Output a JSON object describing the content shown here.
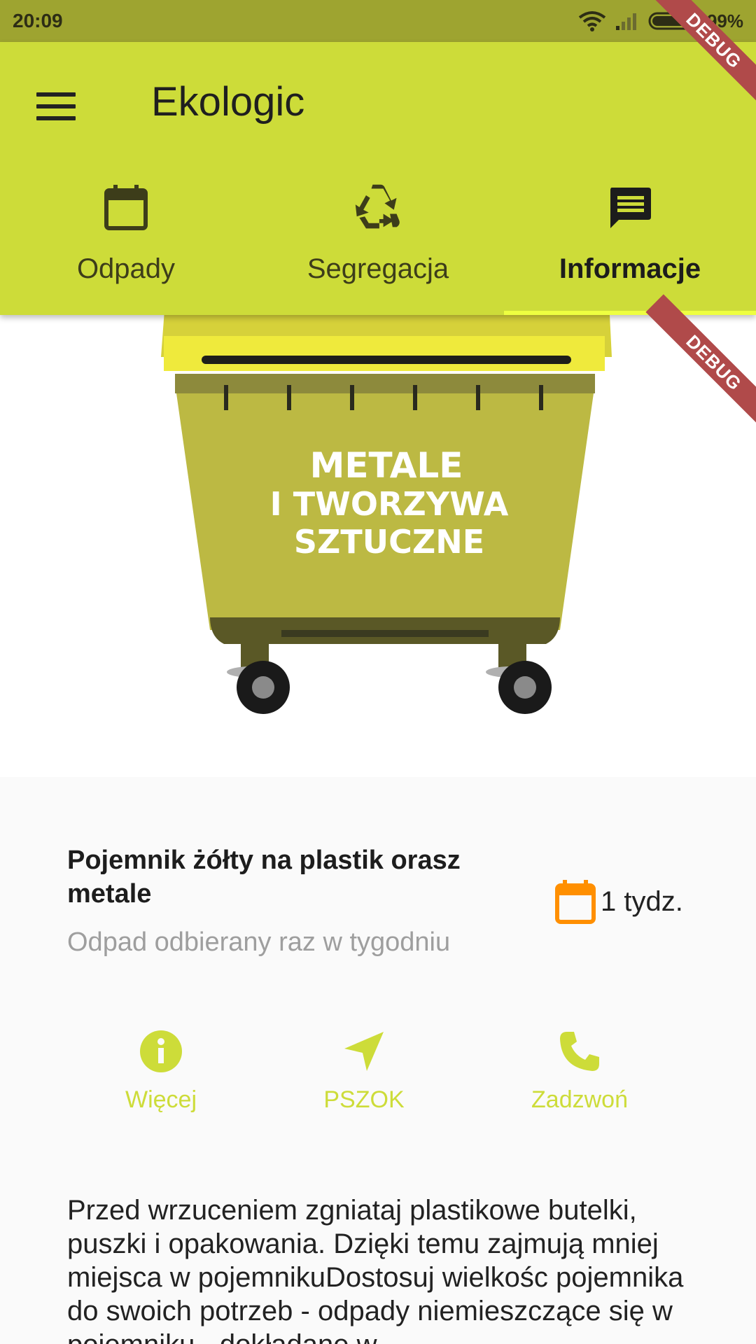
{
  "status": {
    "time": "20:09",
    "battery": "99%"
  },
  "app": {
    "title": "Ekologic"
  },
  "tabs": [
    {
      "label": "Odpady",
      "icon": "calendar-icon"
    },
    {
      "label": "Segregacja",
      "icon": "recycle-icon"
    },
    {
      "label": "Informacje",
      "icon": "message-icon",
      "active": true
    }
  ],
  "debug": {
    "label": "DEBUG"
  },
  "bin": {
    "line1": "METALE",
    "line2": "I TWORZYWA",
    "line3": "SZTUCZNE"
  },
  "info": {
    "title": "Pojemnik żółty na plastik orasz metale",
    "subtitle": "Odpad odbierany raz w tygodniu",
    "frequency": "1 tydz."
  },
  "actions": [
    {
      "label": "Więcej",
      "icon": "info-icon"
    },
    {
      "label": "PSZOK",
      "icon": "navigation-icon"
    },
    {
      "label": "Zadzwoń",
      "icon": "phone-icon"
    }
  ],
  "description": "Przed wrzuceniem zgniataj plastikowe butelki, puszki i opakowania.  Dzięki temu zajmują mniej miejsca w pojemnikuDostosuj wielkośc pojemnika do swoich potrzeb - odpady niemieszczące się w pojemniku - dokładane w",
  "colors": {
    "accent": "#cddc39",
    "status_bar": "#9ea430",
    "calendar_orange": "#ff8f00",
    "tab_indicator": "#eeff41",
    "bin_body": "#bcb943",
    "bin_lid": "#d6d13a"
  }
}
